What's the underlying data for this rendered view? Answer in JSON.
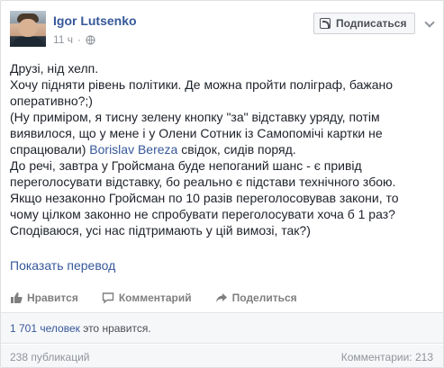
{
  "author": {
    "name": "Igor Lutsenko"
  },
  "meta": {
    "time": "11 ч",
    "privacy_icon": "globe-icon"
  },
  "subscribe": {
    "label": "Подписаться",
    "icon": "rss-icon"
  },
  "menu": {
    "icon": "chevron-down-icon"
  },
  "post": {
    "lines": [
      "Друзі, нід хелп.",
      "Хочу підняти рівень політики. Де можна пройти поліграф, бажано",
      "оперативно?;)",
      "(Ну приміром, я тисну зелену кнопку \"за\" відставку уряду, потім",
      "виявилося, що у мене і у Олени Сотник із Самопомічі картки не"
    ],
    "line6_prefix": "спрацювали) ",
    "line6_link": "Borislav Bereza",
    "line6_suffix": " свідок, сидів поряд.",
    "lines_after": [
      "До речі, завтра у Гройсмана буде непоганий шанс - є привід",
      "переголосувати відставку, бо реально є підстави технічного збою.",
      "Якщо незаконно Гройсман по 10 разів переголосовував закони, то",
      "чому цілком законно не спробувати переголосувати хоча б 1 раз?",
      "Сподіваюся, усі нас підтримають у цій вимозі, так?)"
    ]
  },
  "translate_label": "Показать перевод",
  "actions": {
    "like": "Нравится",
    "comment": "Комментарий",
    "share": "Поделиться"
  },
  "likes": {
    "count": "1 701 человек",
    "suffix": " это нравится."
  },
  "footer": {
    "shares": "238 публикаций",
    "comments": "Комментарии: 213"
  },
  "colors": {
    "link": "#365899",
    "text": "#1d2129",
    "muted": "#90949c",
    "bg": "#f6f7f9"
  }
}
